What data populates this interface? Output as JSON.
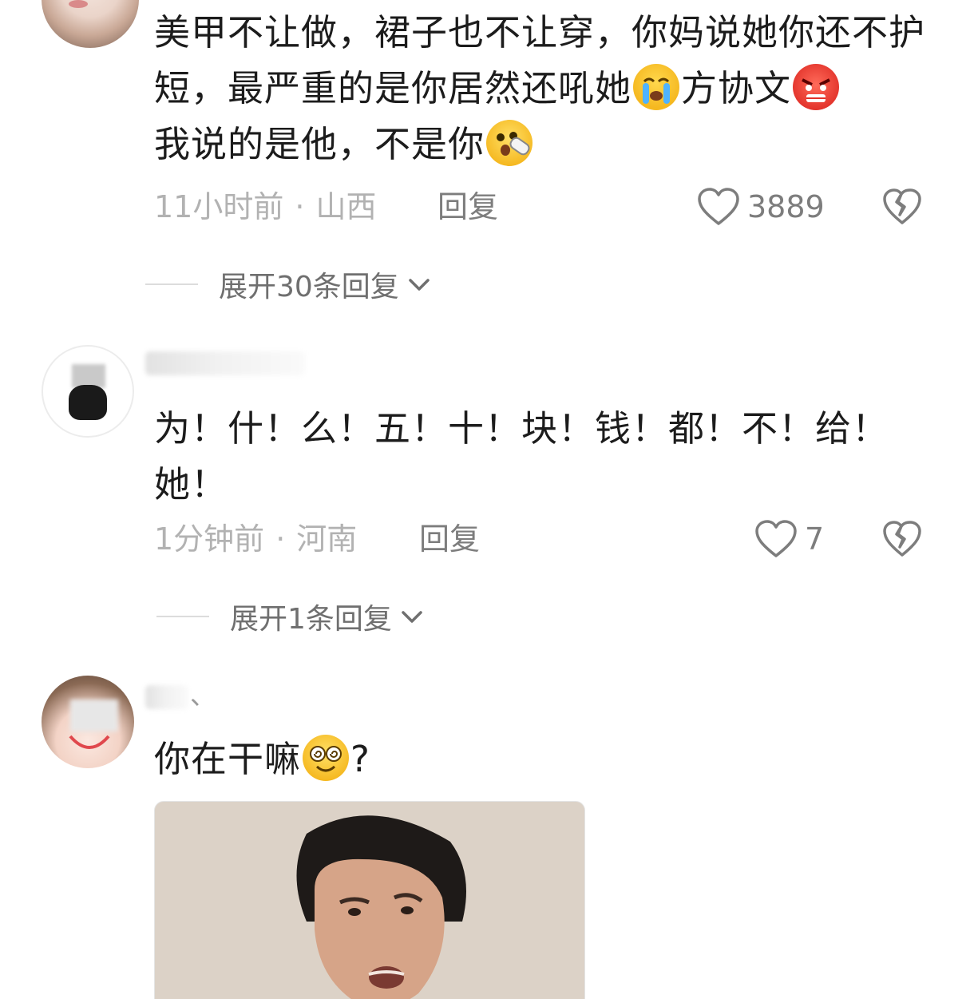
{
  "comments": [
    {
      "text_parts": [
        "美甲不让做，裙子也不让穿，你妈说她你还不护短，最严重的是你居然还吼她",
        "方协文",
        "我说的是他，不是你"
      ],
      "emojis": [
        "crying-face-emoji",
        "angry-face-emoji",
        "shocked-slipper-emoji"
      ],
      "time": "11小时前",
      "location": "山西",
      "reply_label": "回复",
      "likes": "3889",
      "expand_label": "展开30条回复"
    },
    {
      "text": "为！什！么！五！十！块！钱！都！不！给！她！",
      "time": "1分钟前",
      "location": "河南",
      "reply_label": "回复",
      "likes": "7",
      "expand_label": "展开1条回复"
    },
    {
      "username_tail": "、",
      "text_parts": [
        "你在干嘛",
        "?"
      ],
      "emojis": [
        "dizzy-eyes-smile-emoji"
      ]
    }
  ],
  "meta_separator": "·",
  "colors": {
    "text": "#1c1c1c",
    "meta": "#b2b2b2",
    "action": "#7d7d7d",
    "divider": "#dcdcdc"
  },
  "icons": [
    "heart-outline-icon",
    "broken-heart-icon",
    "chevron-down-icon"
  ]
}
